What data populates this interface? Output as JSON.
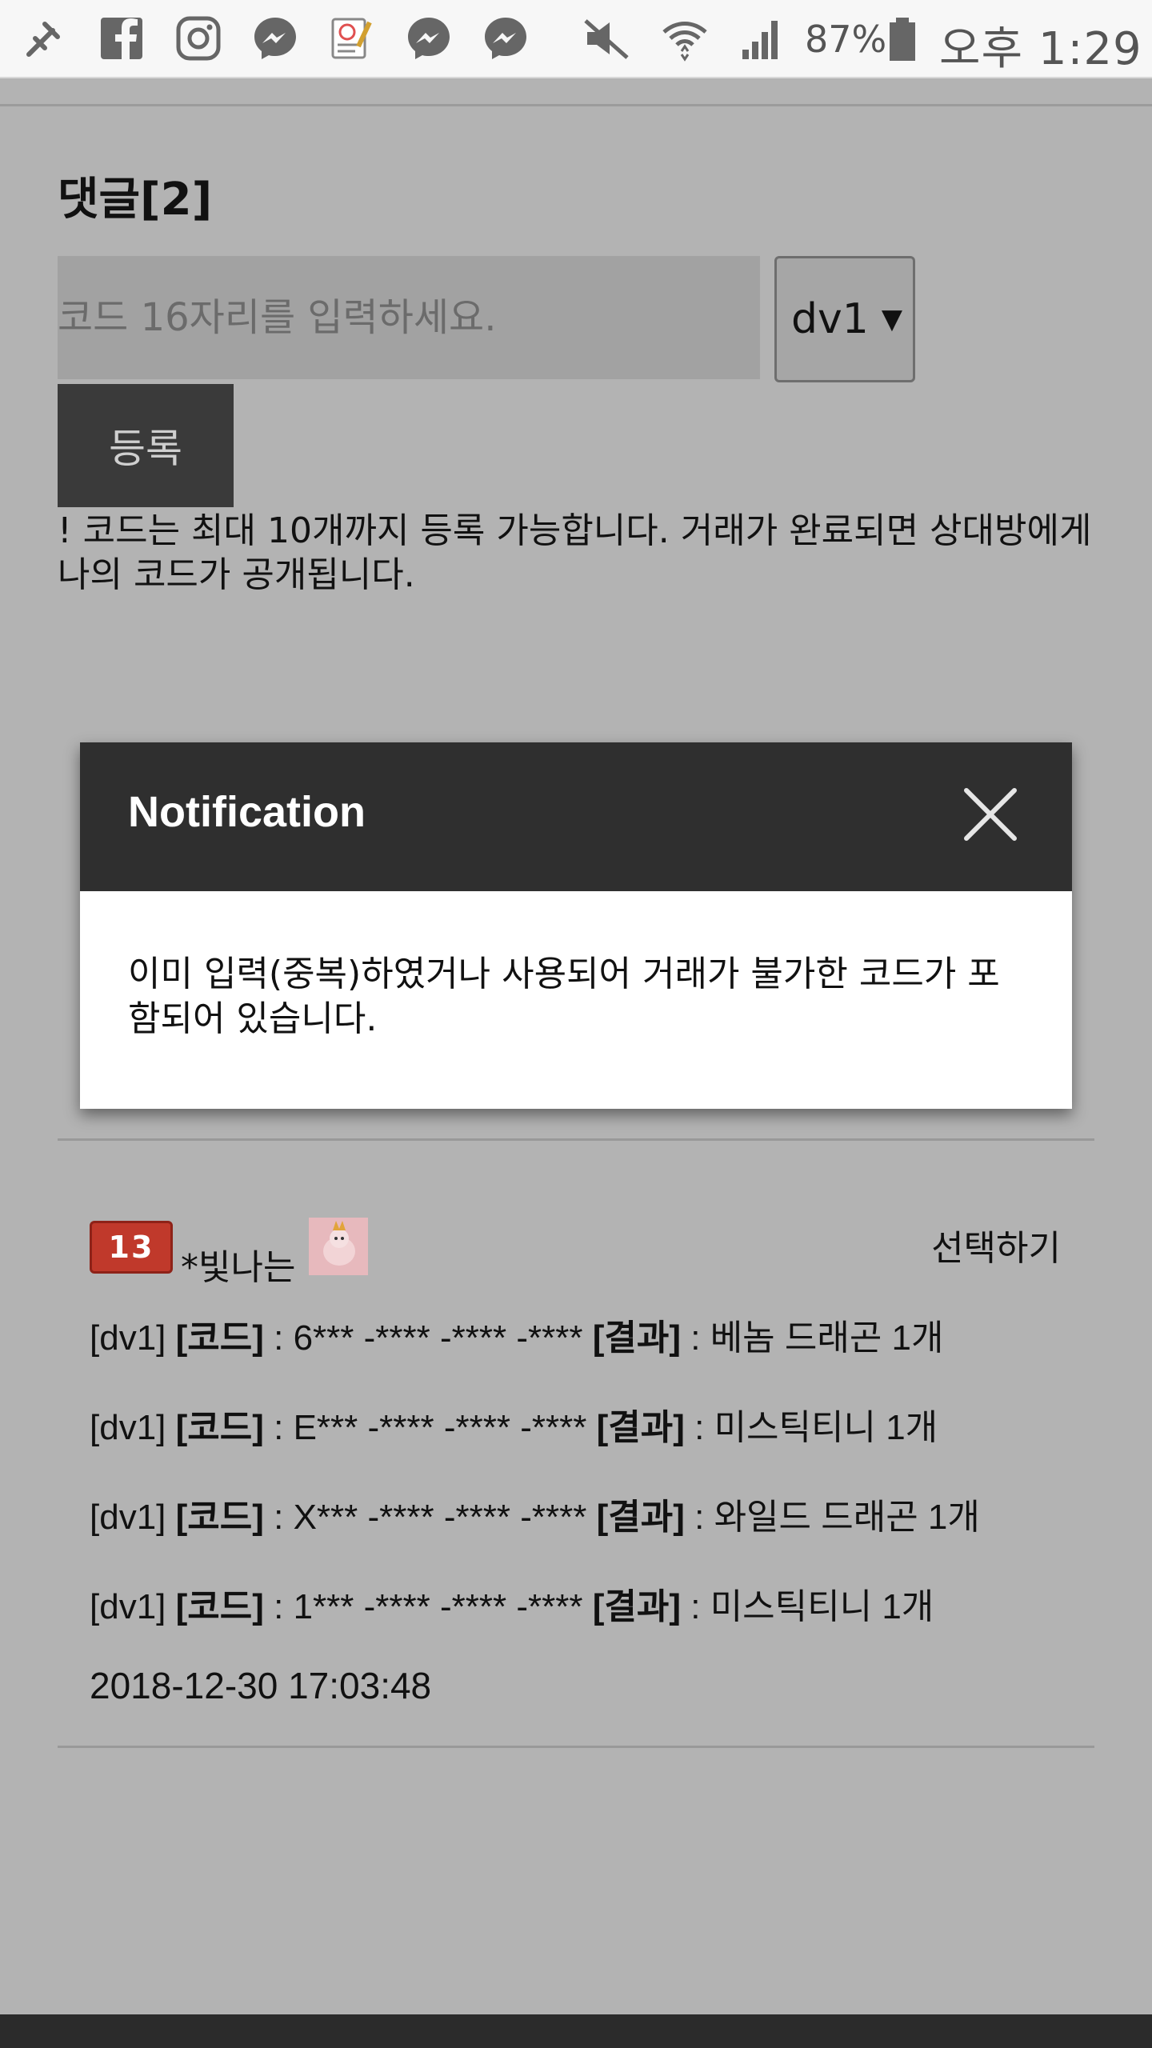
{
  "status_bar": {
    "icons": [
      "usb-debug-icon",
      "facebook-icon",
      "instagram-icon",
      "messenger-icon",
      "notes-app-icon",
      "messenger-icon",
      "messenger-icon",
      "mute-icon",
      "wifi-icon",
      "signal-icon",
      "battery-icon"
    ],
    "battery_percent": "87%",
    "time": "오후 1:29"
  },
  "comments_section": {
    "title": "댓글[2]",
    "code_input_placeholder": "코드 16자리를 입력하세요.",
    "server_select_value": "dv1",
    "register_button_label": "등록",
    "notice": "! 코드는 최대 10개까지 등록 가능합니다. 거래가 완료되면 상대방에게 나의 코드가 공개됩니다."
  },
  "modal": {
    "title": "Notification",
    "message": "이미 입력(중복)하였거나 사용되어 거래가 불가한 코드가 포함되어 있습니다."
  },
  "comment": {
    "level_badge": "13",
    "username": "*빛나는",
    "select_label": "선택하기",
    "trades": [
      {
        "server": "[dv1]",
        "code_label": "[코드]",
        "code": " : 6*** -**** -**** -****",
        "result_label": "[결과]",
        "result": " : 베놈 드래곤 1개"
      },
      {
        "server": "[dv1]",
        "code_label": "[코드]",
        "code": " : E*** -**** -**** -****",
        "result_label": "[결과]",
        "result": " : 미스틱티니 1개"
      },
      {
        "server": "[dv1]",
        "code_label": "[코드]",
        "code": " : X*** -**** -**** -****",
        "result_label": "[결과]",
        "result": " : 와일드 드래곤 1개"
      },
      {
        "server": "[dv1]",
        "code_label": "[코드]",
        "code": " : 1*** -**** -**** -****",
        "result_label": "[결과]",
        "result": " : 미스틱티니 1개"
      }
    ],
    "timestamp": "2018-12-30 17:03:48"
  }
}
